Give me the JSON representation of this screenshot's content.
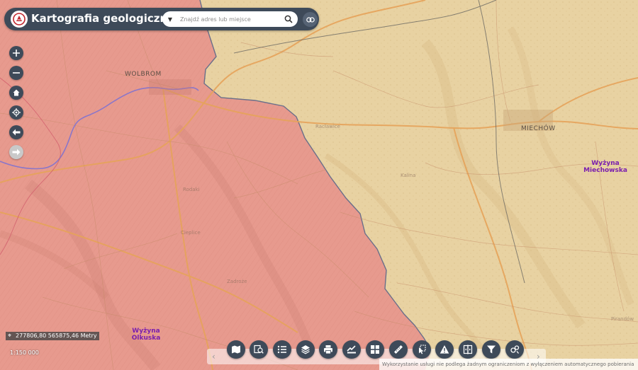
{
  "header": {
    "app_title": "Kartografia geologiczna",
    "search_placeholder": "Znajdź adres lub miejsce"
  },
  "map": {
    "places": [
      {
        "name": "WOLBROM"
      },
      {
        "name": "MIECHÓW"
      }
    ],
    "regions": [
      {
        "line1": "Wyżyna",
        "line2": "Miechowska"
      },
      {
        "line1": "Wyżyna",
        "line2": "Olkuska"
      }
    ]
  },
  "status": {
    "coordinates": "277806,80 565875,46 Metry",
    "scale": "1:150 000"
  },
  "toolbar": {
    "buttons": [
      "basemap-icon",
      "identify-icon",
      "legend-icon",
      "layers-icon",
      "print-icon",
      "share-icon",
      "gallery-icon",
      "measure-icon",
      "select-icon",
      "warning-icon",
      "compare-icon",
      "filter-icon",
      "tools-icon"
    ]
  },
  "disclaimer": "Wykorzystanie usługi nie podlega żadnym ograniczeniom z wyłączeniem automatycznego pobierania",
  "colors": {
    "header_bg": "#3e4a59",
    "red_unit": "#e79a8e",
    "yellow_unit": "#e8d2a2",
    "region_label": "#7a1fae"
  }
}
